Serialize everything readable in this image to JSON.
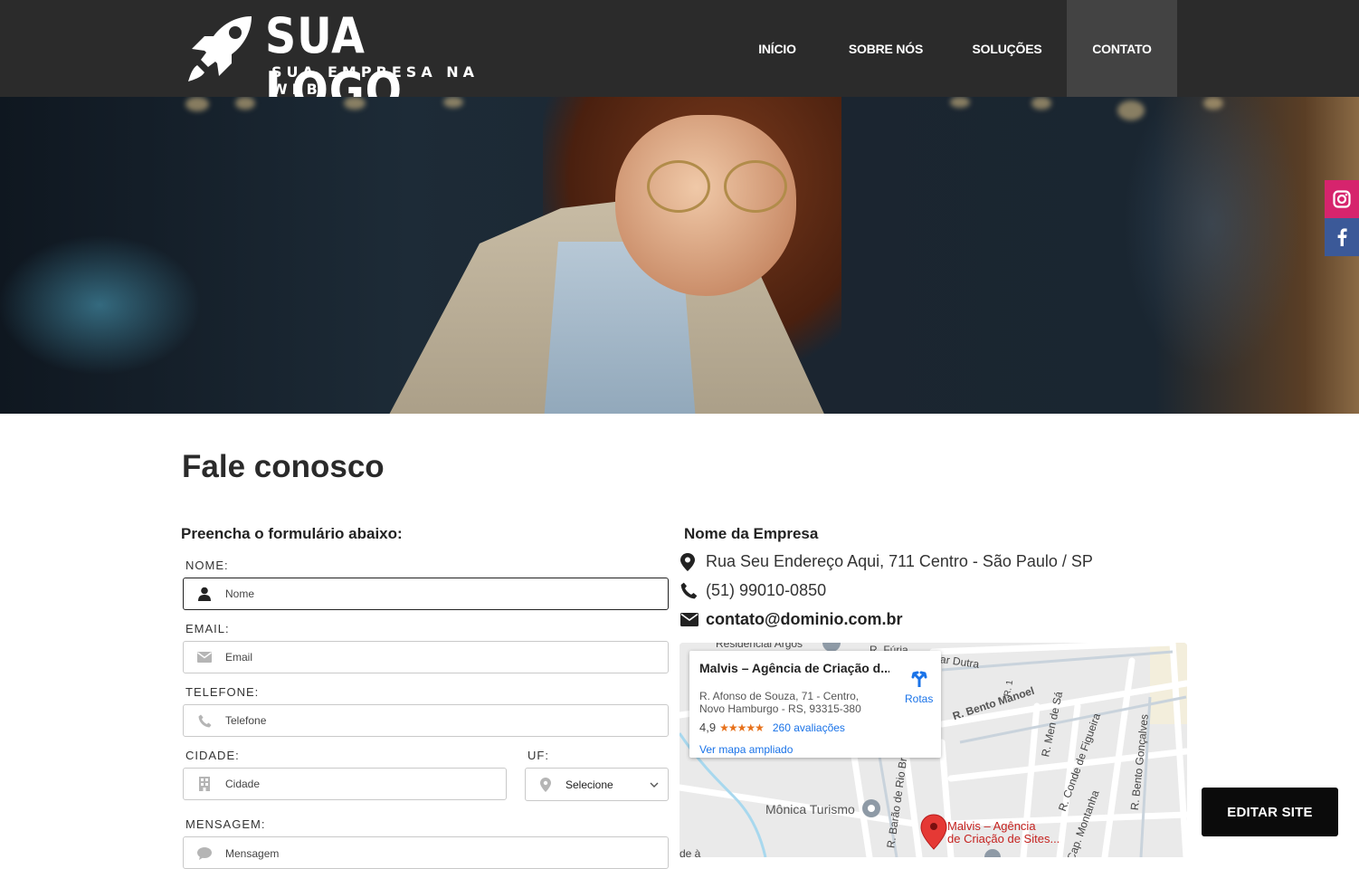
{
  "brand": {
    "logo_title": "SUA LOGO",
    "logo_subtitle": "SUA EMPRESA NA WEB",
    "icon": "rocket-icon"
  },
  "nav": {
    "items": [
      {
        "label": "INÍCIO",
        "active": false
      },
      {
        "label": "SOBRE NÓS",
        "active": false
      },
      {
        "label": "SOLUÇÕES",
        "active": false
      },
      {
        "label": "CONTATO",
        "active": true
      }
    ]
  },
  "social": {
    "instagram_icon": "instagram-icon",
    "facebook_icon": "facebook-icon",
    "instagram_color": "#d6246d",
    "facebook_color": "#3b5998"
  },
  "page": {
    "title": "Fale conosco"
  },
  "form": {
    "heading": "Preencha o formulário abaixo:",
    "nome": {
      "label": "NOME:",
      "placeholder": "Nome",
      "icon": "user-icon"
    },
    "email": {
      "label": "EMAIL:",
      "placeholder": "Email",
      "icon": "envelope-icon"
    },
    "telefone": {
      "label": "TELEFONE:",
      "placeholder": "Telefone",
      "icon": "phone-icon"
    },
    "cidade": {
      "label": "CIDADE:",
      "placeholder": "Cidade",
      "icon": "building-icon"
    },
    "uf": {
      "label": "UF:",
      "selected": "Selecione",
      "icon": "map-pin-icon"
    },
    "mensagem": {
      "label": "MENSAGEM:",
      "placeholder": "Mensagem",
      "icon": "chat-bubble-icon"
    }
  },
  "contact": {
    "company": "Nome da Empresa",
    "address": "Rua Seu Endereço Aqui, 711 Centro - São Paulo / SP",
    "phone": "(51) 99010-0850",
    "email": "contato@dominio.com.br"
  },
  "map": {
    "card_title": "Malvis – Agência de Criação d...",
    "card_address_1": "R. Afonso de Souza, 71 - Centro,",
    "card_address_2": "Novo Hamburgo - RS, 93315-380",
    "rating": "4,9",
    "stars": "★★★★★",
    "reviews": "260 avaliações",
    "directions": "Rotas",
    "larger_map": "Ver mapa ampliado",
    "streets": {
      "residencial": "Residencial Argos",
      "r_furia": "R. Fúria",
      "ar_dutra": "ar Dutra",
      "r_bento_manoel": "R. Bento Manoel",
      "r_men_de_sa": "R. Men de Sá",
      "r_conde": "R. Conde de Figueira",
      "r_bento_goncalves": "R. Bento Gonçalves",
      "r_barao": "R. Barão de Rio Br",
      "cap_montanha": "Cap. Montanha",
      "r_1": "R. 1",
      "de_a": "de à"
    },
    "place": "Mônica Turismo",
    "pin_label_1": "Malvis – Agência",
    "pin_label_2": "de Criação de Sites..."
  },
  "edit_button": "EDITAR SITE"
}
